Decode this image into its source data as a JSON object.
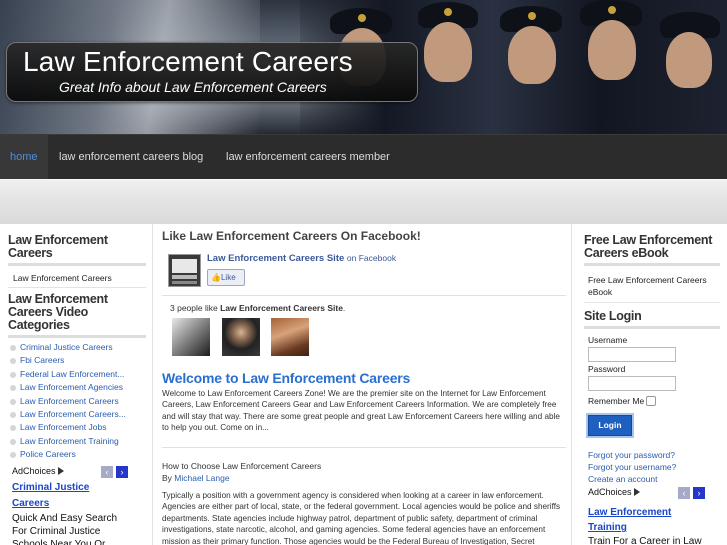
{
  "header": {
    "title": "Law Enforcement Careers",
    "tagline": "Great Info about Law Enforcement Careers"
  },
  "nav": {
    "items": [
      {
        "label": "home",
        "active": true
      },
      {
        "label": "law enforcement careers blog",
        "active": false
      },
      {
        "label": "law enforcement careers member",
        "active": false
      }
    ]
  },
  "left_sidebar": {
    "widget1": {
      "title": "Law Enforcement Careers",
      "item": "Law Enforcement Careers"
    },
    "widget2": {
      "title": "Law Enforcement Careers Video Categories",
      "items": [
        "Criminal Justice Careers",
        "Fbi Careers",
        "Federal Law Enforcement...",
        "Law Enforcement Agencies",
        "Law Enforcement Careers",
        "Law Enforcement Careers...",
        "Law Enforcement Jobs",
        "Law Enforcement Training",
        "Police Careers"
      ]
    },
    "ad": {
      "adchoices": "AdChoices",
      "prev": "‹",
      "next": "›",
      "link": "Criminal Justice Careers",
      "text": "Quick And Easy Search For Criminal Justice Schools Near You Or Online!"
    }
  },
  "main": {
    "fb_heading": "Like Law Enforcement Careers On Facebook!",
    "fb_page_name": "Law Enforcement Careers Site",
    "fb_on": "on Facebook",
    "fb_like": "Like",
    "fb_count_prefix": "3 people like ",
    "fb_count_name": "Law Enforcement Careers Site",
    "fb_count_suffix": ".",
    "post1": {
      "title": "Welcome to Law Enforcement Careers",
      "body": "Welcome to Law Enforcement Careers Zone! We are the premier site on the Internet for Law Enforcement Careers, Law Enforcement Careers Gear and Law Enforcement Careers Information. We are completely free and will stay that way. There are some great people and great Law Enforcement Careers here willing and able to help you out. Come on in..."
    },
    "post2": {
      "title": "How to Choose Law Enforcement Careers",
      "by_prefix": "By ",
      "author": "Michael Lange",
      "body": "Typically a position with a government agency is considered when looking at a career in law enforcement. Agencies are either part of local, state, or the federal government. Local agencies would be police and sheriffs departments. State agencies include highway patrol, department of public safety, department of criminal investigations, state narcotic, alcohol, and gaming agencies. Some federal agencies have an enforcement mission as their primary function. Those agencies would be the Federal Bureau of Investigation, Secret"
    }
  },
  "right_sidebar": {
    "ebook": {
      "title": "Free Law Enforcement Careers eBook",
      "item": "Free Law Enforcement Careers eBook"
    },
    "login": {
      "title": "Site Login",
      "username_label": "Username",
      "password_label": "Password",
      "remember_label": "Remember Me",
      "button": "Login",
      "forgot_password": "Forgot your password?",
      "forgot_username": "Forgot your username?",
      "create_account": "Create an account"
    },
    "ad": {
      "adchoices": "AdChoices",
      "prev": "‹",
      "next": "›",
      "link": "Law Enforcement Training",
      "text": "Train For a Career in Law"
    }
  },
  "colors": {
    "nav_bg": "#2c2c2c",
    "nav_active_text": "#4c8fe0",
    "link_blue": "#2a5db0",
    "facebook_blue": "#3b5998",
    "post_title_blue": "#2a6fd0"
  }
}
